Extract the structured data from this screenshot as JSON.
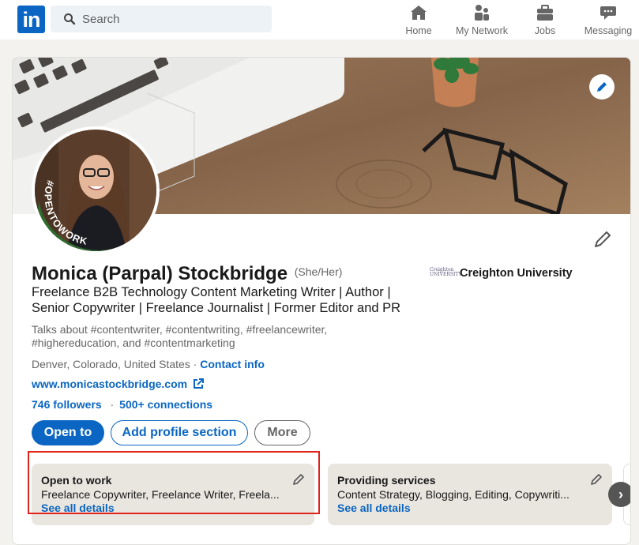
{
  "topnav": {
    "logo_text": "in",
    "search": {
      "placeholder": "Search",
      "value": ""
    },
    "items": [
      {
        "label": "Home",
        "icon": "home-icon"
      },
      {
        "label": "My Network",
        "icon": "network-icon"
      },
      {
        "label": "Jobs",
        "icon": "briefcase-icon"
      },
      {
        "label": "Messaging",
        "icon": "message-icon"
      }
    ]
  },
  "profile": {
    "avatar_frame_text": "#OPENTOWORK",
    "name": "Monica (Parpal) Stockbridge",
    "pronouns": "(She/Her)",
    "headline": "Freelance B2B Technology Content Marketing Writer | Author | Senior Copywriter | Freelance Journalist | Former Editor and PR",
    "education": {
      "logo_text": "Creighton UNIVERSITY",
      "name": "Creighton University"
    },
    "talks_about": "Talks about #contentwriter, #contentwriting, #freelancewriter, #highereducation, and #contentmarketing",
    "location": "Denver, Colorado, United States",
    "location_sep": "·",
    "contact_info": "Contact info",
    "website": "www.monicastockbridge.com",
    "followers": "746 followers",
    "stats_sep": "·",
    "connections": "500+ connections",
    "buttons": {
      "open_to": "Open to",
      "add_section": "Add profile section",
      "more": "More"
    },
    "panels": [
      {
        "title": "Open to work",
        "description": "Freelance Copywriter, Freelance Writer, Freela...",
        "details": "See all details"
      },
      {
        "title": "Providing services",
        "description": "Content Strategy, Blogging, Editing, Copywriti...",
        "details": "See all details"
      }
    ],
    "next_glyph": "›"
  },
  "colors": {
    "brand": "#0a66c2",
    "highlight": "#e0241b",
    "opentowork_green": "#2e6b2f"
  }
}
